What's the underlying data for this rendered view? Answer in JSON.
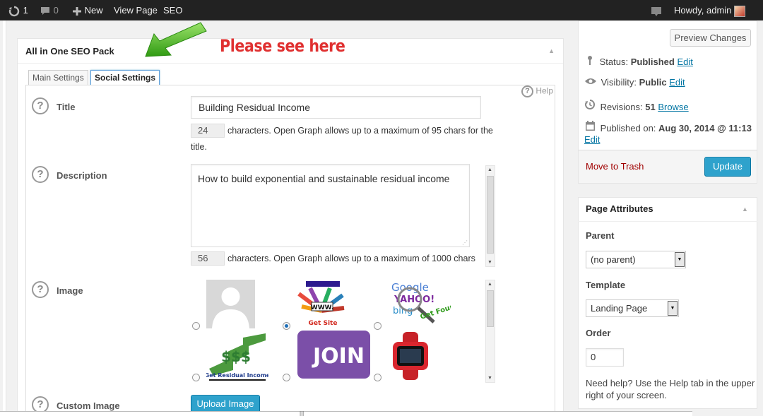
{
  "adminbar": {
    "updates_count": "1",
    "comments_count": "0",
    "new_label": "New",
    "view_page_label": "View Page",
    "seo_label": "SEO",
    "howdy": "Howdy, admin"
  },
  "metabox": {
    "title": "All in One SEO Pack",
    "annotation": "Please see here",
    "tabs": [
      "Main Settings",
      "Social Settings"
    ],
    "help_label": "Help"
  },
  "fields": {
    "title": {
      "label": "Title",
      "value": "Building Residual Income",
      "count": "24",
      "note_line1": "characters. Open Graph allows up to a maximum of 95 chars for the",
      "note_line2": "title."
    },
    "description": {
      "label": "Description",
      "value": "How to build exponential and sustainable residual income",
      "count": "56",
      "note": "characters. Open Graph allows up to a maximum of 1000 chars"
    },
    "image": {
      "label": "Image",
      "selected_index": 1,
      "thumbs": [
        {
          "name": "avatar placeholder"
        },
        {
          "caption": "Get Site",
          "banner": "WWW."
        },
        {
          "caption": "Get Found!"
        },
        {
          "caption": "Get Residual Income"
        },
        {
          "text": "JOIN H"
        },
        {
          "name": "smartwatch"
        }
      ]
    },
    "custom_image": {
      "label": "Custom Image",
      "button": "Upload Image"
    }
  },
  "publish": {
    "preview_button": "Preview Changes",
    "status_label": "Status:",
    "status_value": "Published",
    "visibility_label": "Visibility:",
    "visibility_value": "Public",
    "revisions_label": "Revisions:",
    "revisions_value": "51",
    "browse_link": "Browse",
    "published_on_label": "Published on:",
    "published_on_value": "Aug 30, 2014 @ 11:13",
    "edit_link": "Edit",
    "trash_link": "Move to Trash",
    "update_button": "Update"
  },
  "page_attributes": {
    "title": "Page Attributes",
    "parent_label": "Parent",
    "parent_value": "(no parent)",
    "template_label": "Template",
    "template_value": "Landing Page",
    "order_label": "Order",
    "order_value": "0",
    "help_line1": "Need help? Use the Help tab in the upper",
    "help_line2": "right of your screen."
  },
  "colors": {
    "adminbar_bg": "#222222",
    "primary_button": "#2ea2cc",
    "link": "#0074a2",
    "trash": "#a00000",
    "annotation": "#e03030",
    "arrow": "#3fb51f"
  }
}
